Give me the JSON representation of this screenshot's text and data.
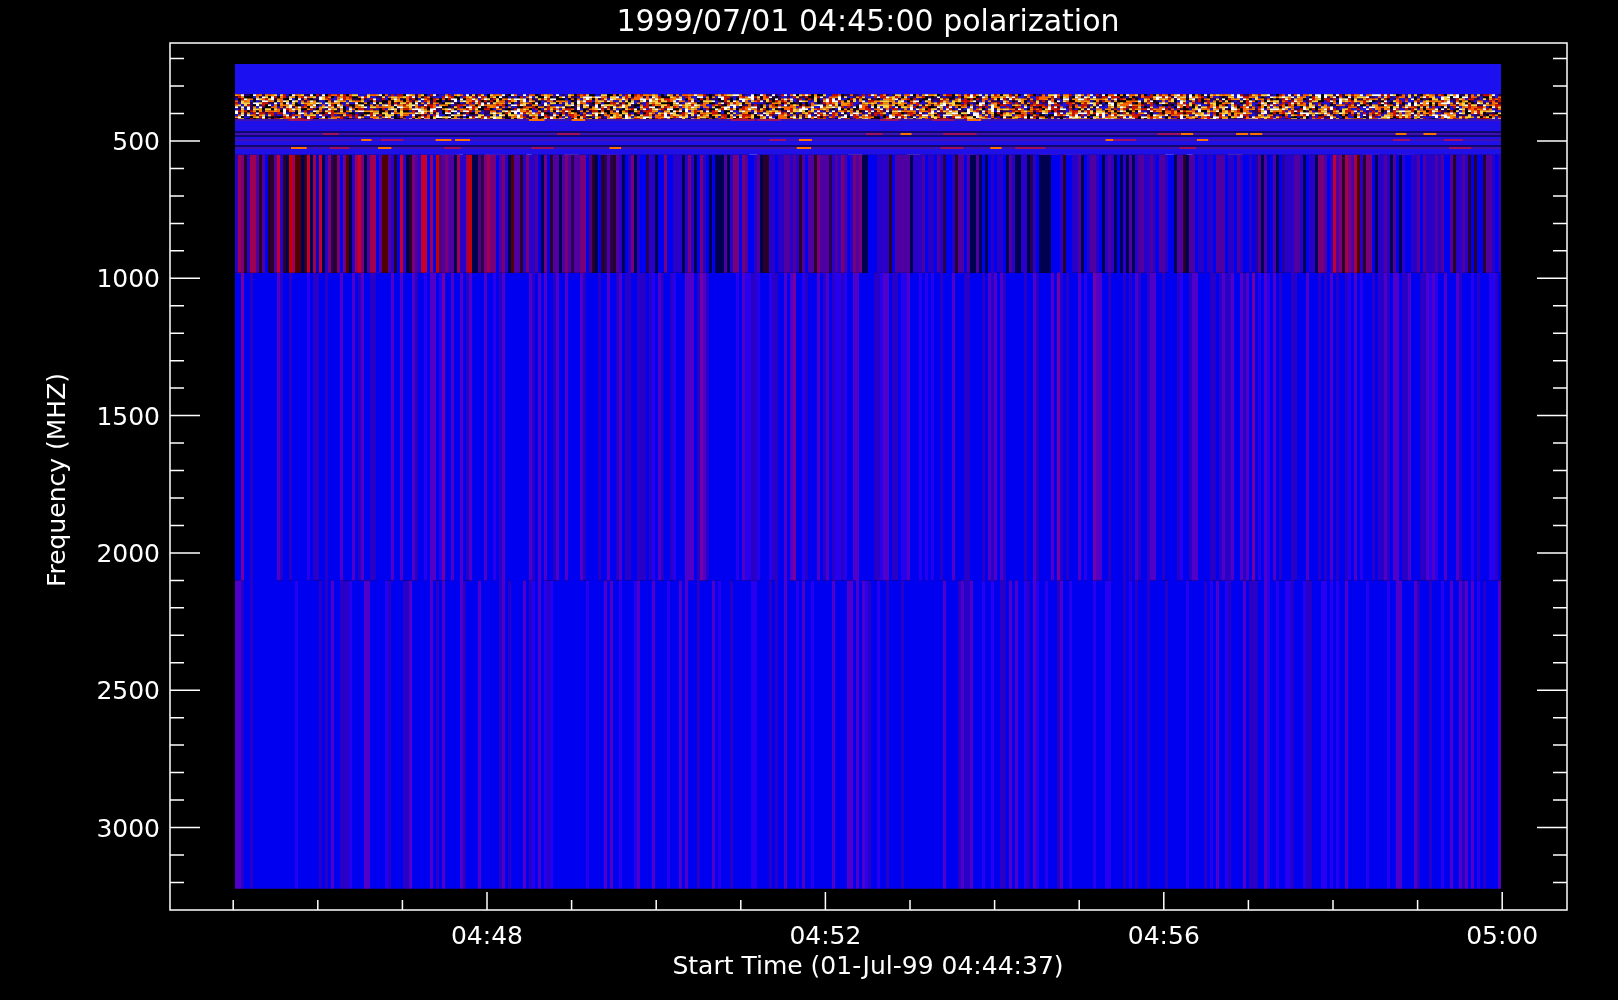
{
  "plot": {
    "title": "1999/07/01 04:45:00 polarization",
    "xlabel": "Start Time (01-Jul-99 04:44:37)",
    "ylabel": "Frequency (MHZ)",
    "y_tick_labels": [
      "500",
      "1000",
      "1500",
      "2000",
      "2500",
      "3000"
    ],
    "x_tick_labels": [
      "04:48",
      "04:52",
      "04:56",
      "05:00"
    ]
  }
}
